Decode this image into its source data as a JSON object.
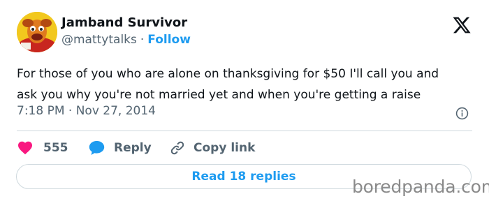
{
  "author": {
    "display_name": "Jamband Survivor",
    "handle": "@mattytalks",
    "separator": "·",
    "follow_label": "Follow",
    "avatar_icon": "muppet-avatar"
  },
  "tweet": {
    "lines": [
      "For those of you who are alone on thanksgiving for $50 I'll call you and",
      "ask you why you're not married yet and when you're getting a raise"
    ],
    "timestamp": "7:18 PM · Nov 27, 2014"
  },
  "actions": {
    "likes_count": "555",
    "reply_label": "Reply",
    "copy_link_label": "Copy link"
  },
  "read_replies_label": "Read 18 replies",
  "watermark": "boredpanda.com",
  "colors": {
    "accent": "#1d9bf0",
    "like": "#f91880",
    "secondary_text": "#536471",
    "text": "#0f1419",
    "border": "#cfd9de"
  },
  "icons": {
    "brand": "x-logo-icon",
    "info": "info-icon",
    "like": "heart-icon",
    "reply": "speech-bubble-icon",
    "copy_link": "link-icon"
  }
}
